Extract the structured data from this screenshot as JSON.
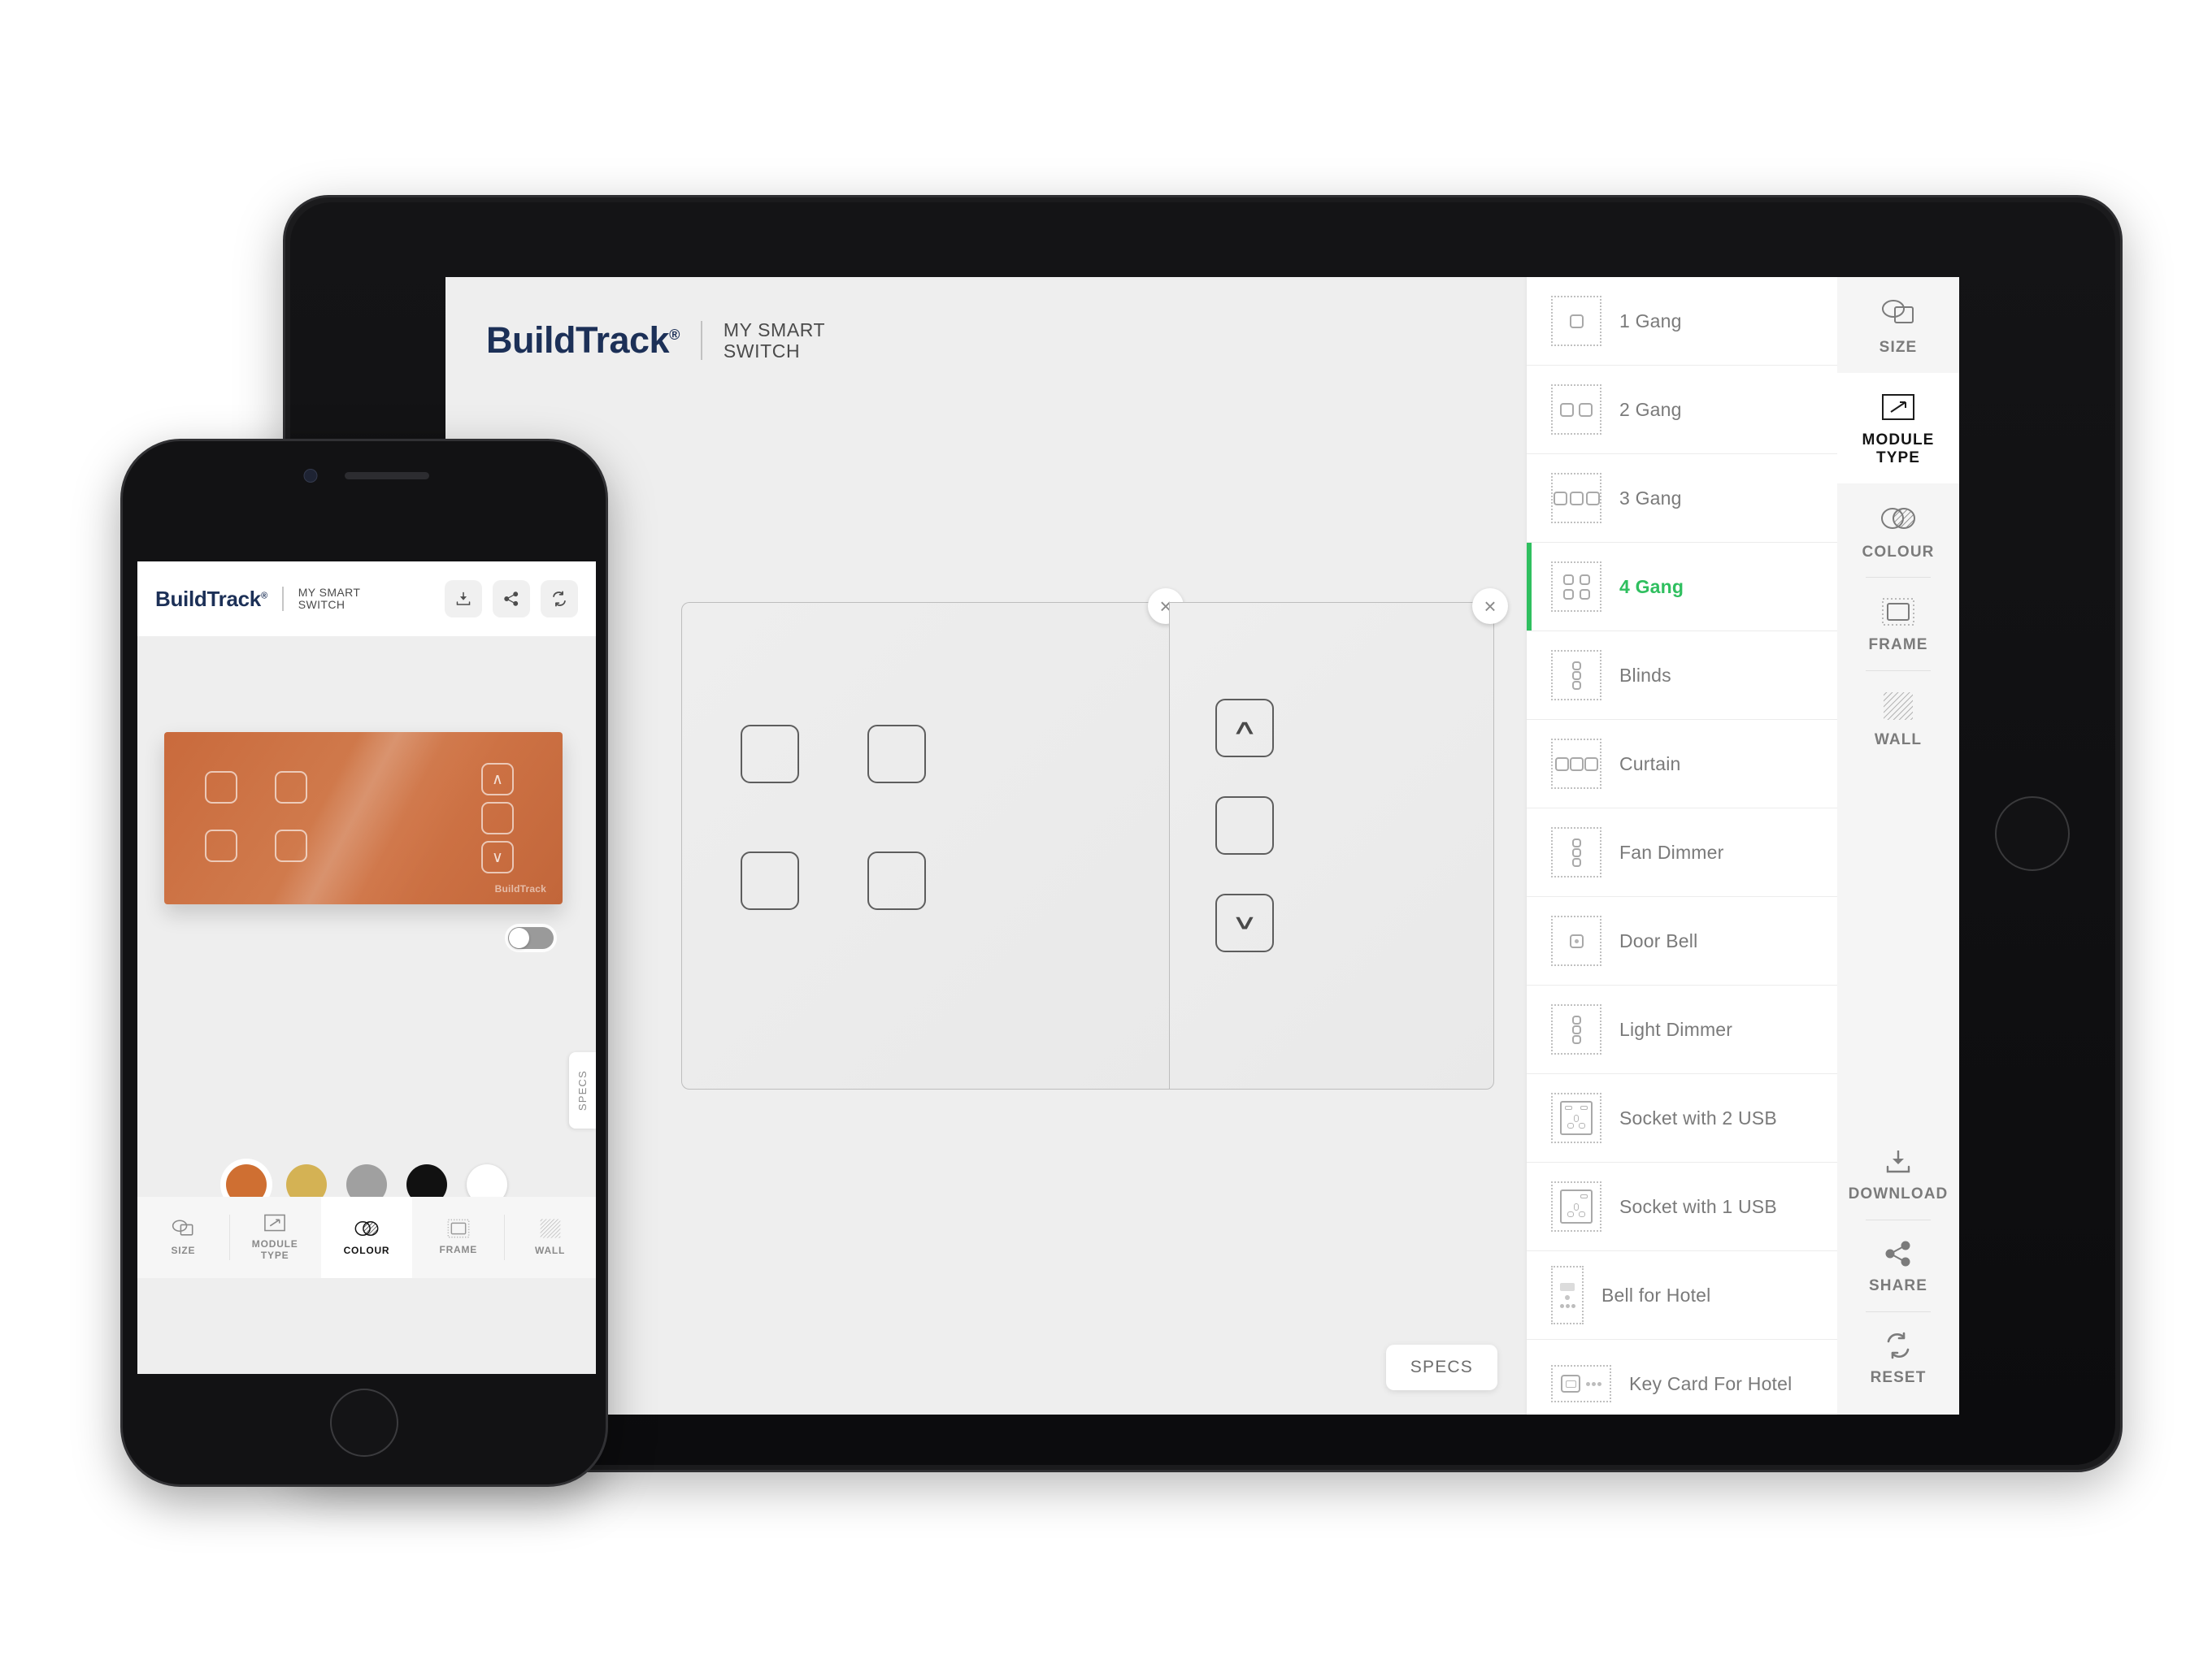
{
  "brand": {
    "name": "BuildTrack",
    "registered": "®",
    "product_line_1": "MY SMART",
    "product_line_2": "SWITCH"
  },
  "colors": {
    "accent_green": "#2fbf5f",
    "logo_navy": "#1c3057",
    "canvas_bg": "#eeeeee",
    "panel_copper": "#cc7044"
  },
  "tablet": {
    "canvas": {
      "left_panel": {
        "close_label": "×",
        "buttons": [
          "",
          "",
          "",
          ""
        ]
      },
      "right_panel": {
        "close_label": "×",
        "buttons": [
          "∧",
          "",
          "∨"
        ]
      },
      "specs_button": "SPECS"
    },
    "module_list": [
      {
        "label": "1 Gang",
        "icon": "gang-1-icon"
      },
      {
        "label": "2 Gang",
        "icon": "gang-2-icon"
      },
      {
        "label": "3 Gang",
        "icon": "gang-3-icon"
      },
      {
        "label": "4 Gang",
        "icon": "gang-4-icon",
        "selected": true
      },
      {
        "label": "Blinds",
        "icon": "blinds-icon"
      },
      {
        "label": "Curtain",
        "icon": "curtain-icon"
      },
      {
        "label": "Fan Dimmer",
        "icon": "fan-dimmer-icon"
      },
      {
        "label": "Door Bell",
        "icon": "door-bell-icon"
      },
      {
        "label": "Light Dimmer",
        "icon": "light-dimmer-icon"
      },
      {
        "label": "Socket with 2 USB",
        "icon": "socket-2usb-icon"
      },
      {
        "label": "Socket with 1 USB",
        "icon": "socket-1usb-icon"
      },
      {
        "label": "Bell for Hotel",
        "icon": "bell-hotel-icon"
      },
      {
        "label": "Key Card For Hotel",
        "icon": "key-card-hotel-icon"
      }
    ],
    "tools": [
      {
        "label": "SIZE",
        "icon": "size-icon"
      },
      {
        "label": "MODULE\nTYPE",
        "icon": "module-type-icon",
        "active": true
      },
      {
        "label": "COLOUR",
        "icon": "colour-icon"
      },
      {
        "label": "FRAME",
        "icon": "frame-icon"
      },
      {
        "label": "WALL",
        "icon": "wall-icon"
      }
    ],
    "tools_bottom": [
      {
        "label": "DOWNLOAD",
        "icon": "download-icon"
      },
      {
        "label": "SHARE",
        "icon": "share-icon"
      },
      {
        "label": "RESET",
        "icon": "reset-icon"
      }
    ]
  },
  "phone": {
    "header_actions": [
      {
        "name": "download-icon"
      },
      {
        "name": "share-icon"
      },
      {
        "name": "reset-icon"
      }
    ],
    "switch_preview": {
      "brand_mark": "BuildTrack",
      "panel_color": "#cc7044",
      "left_buttons": [
        "",
        "",
        "",
        ""
      ],
      "right_buttons": [
        "∧",
        "",
        "∨"
      ]
    },
    "toggle_state": "off",
    "specs_tab": "SPECS",
    "colour_swatches": [
      {
        "name": "copper",
        "hex": "#cf6f32",
        "selected": true
      },
      {
        "name": "gold",
        "hex": "#d4b254",
        "selected": false
      },
      {
        "name": "grey",
        "hex": "#a0a0a0",
        "selected": false
      },
      {
        "name": "black",
        "hex": "#111111",
        "selected": false
      },
      {
        "name": "white",
        "hex": "#ffffff",
        "selected": false
      }
    ],
    "tabs": [
      {
        "label": "SIZE",
        "icon": "size-icon"
      },
      {
        "label": "MODULE\nTYPE",
        "icon": "module-type-icon"
      },
      {
        "label": "COLOUR",
        "icon": "colour-icon",
        "active": true
      },
      {
        "label": "FRAME",
        "icon": "frame-icon"
      },
      {
        "label": "WALL",
        "icon": "wall-icon"
      }
    ]
  }
}
